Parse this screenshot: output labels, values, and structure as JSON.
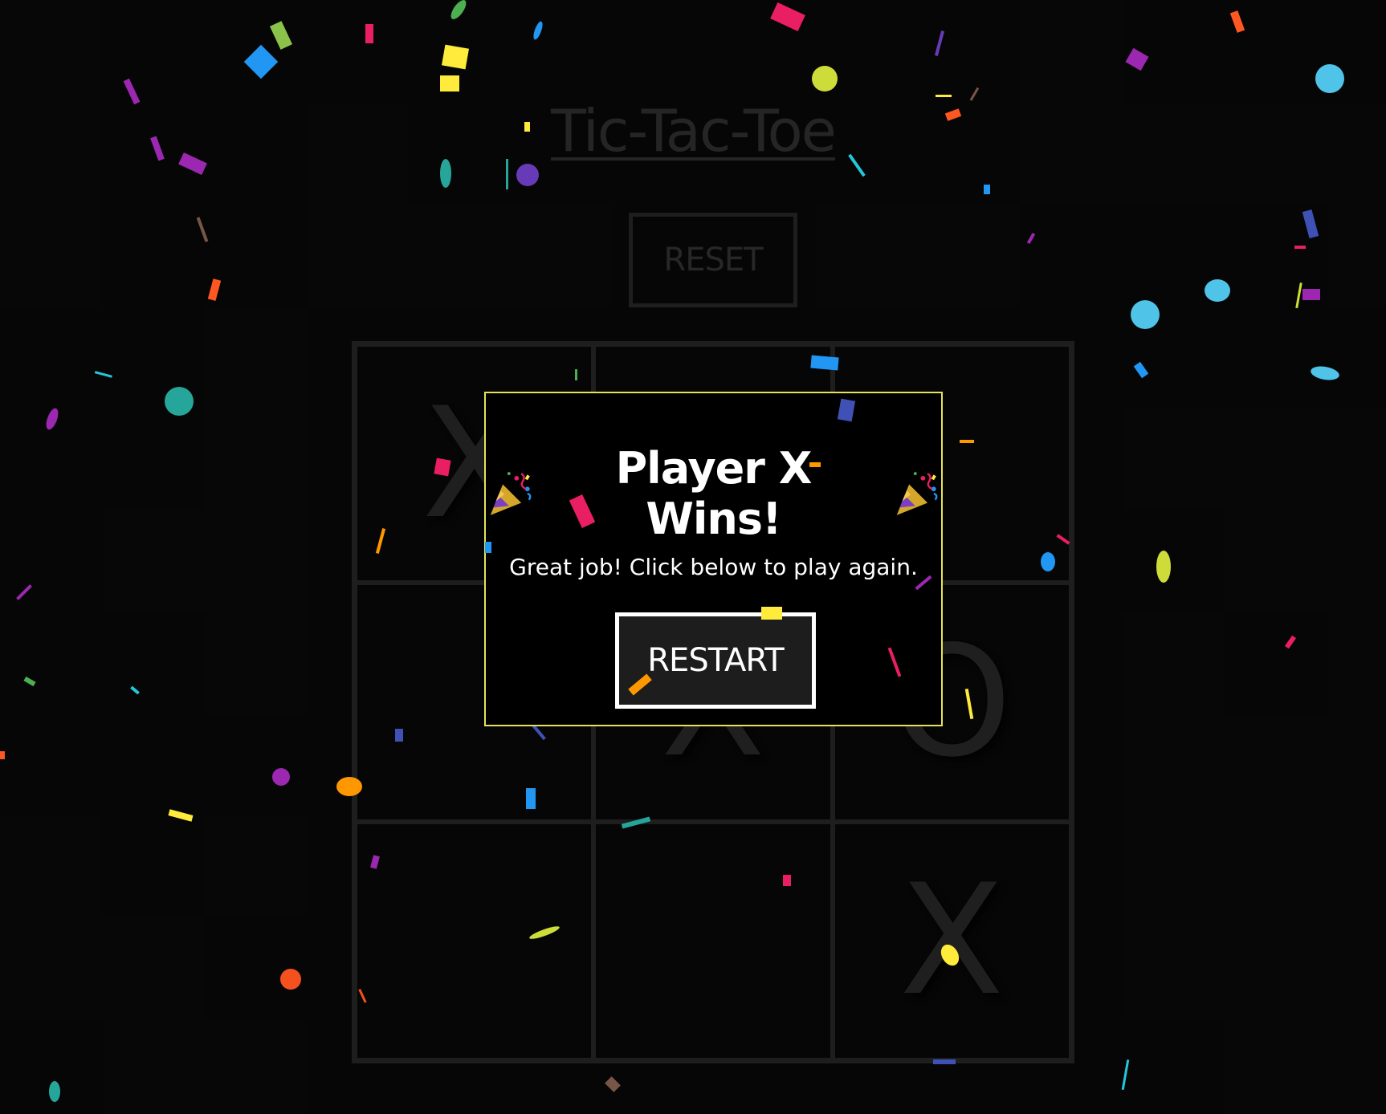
{
  "game": {
    "title": "Tic-Tac-Toe",
    "reset_label": "RESET"
  },
  "board": {
    "cells": [
      "X",
      "",
      "",
      "",
      "X",
      "O",
      "",
      "",
      "X"
    ]
  },
  "modal": {
    "title": "Player X Wins!",
    "message": "Great job! Click below to play again.",
    "restart_label": "RESTART",
    "icon_left": "party-popper-icon",
    "icon_right": "party-popper-icon"
  },
  "colors": {
    "background": "#0a0a0a",
    "grid": "#2f2f2f",
    "mark": "#303030",
    "modal_border": "#e6e35a"
  }
}
